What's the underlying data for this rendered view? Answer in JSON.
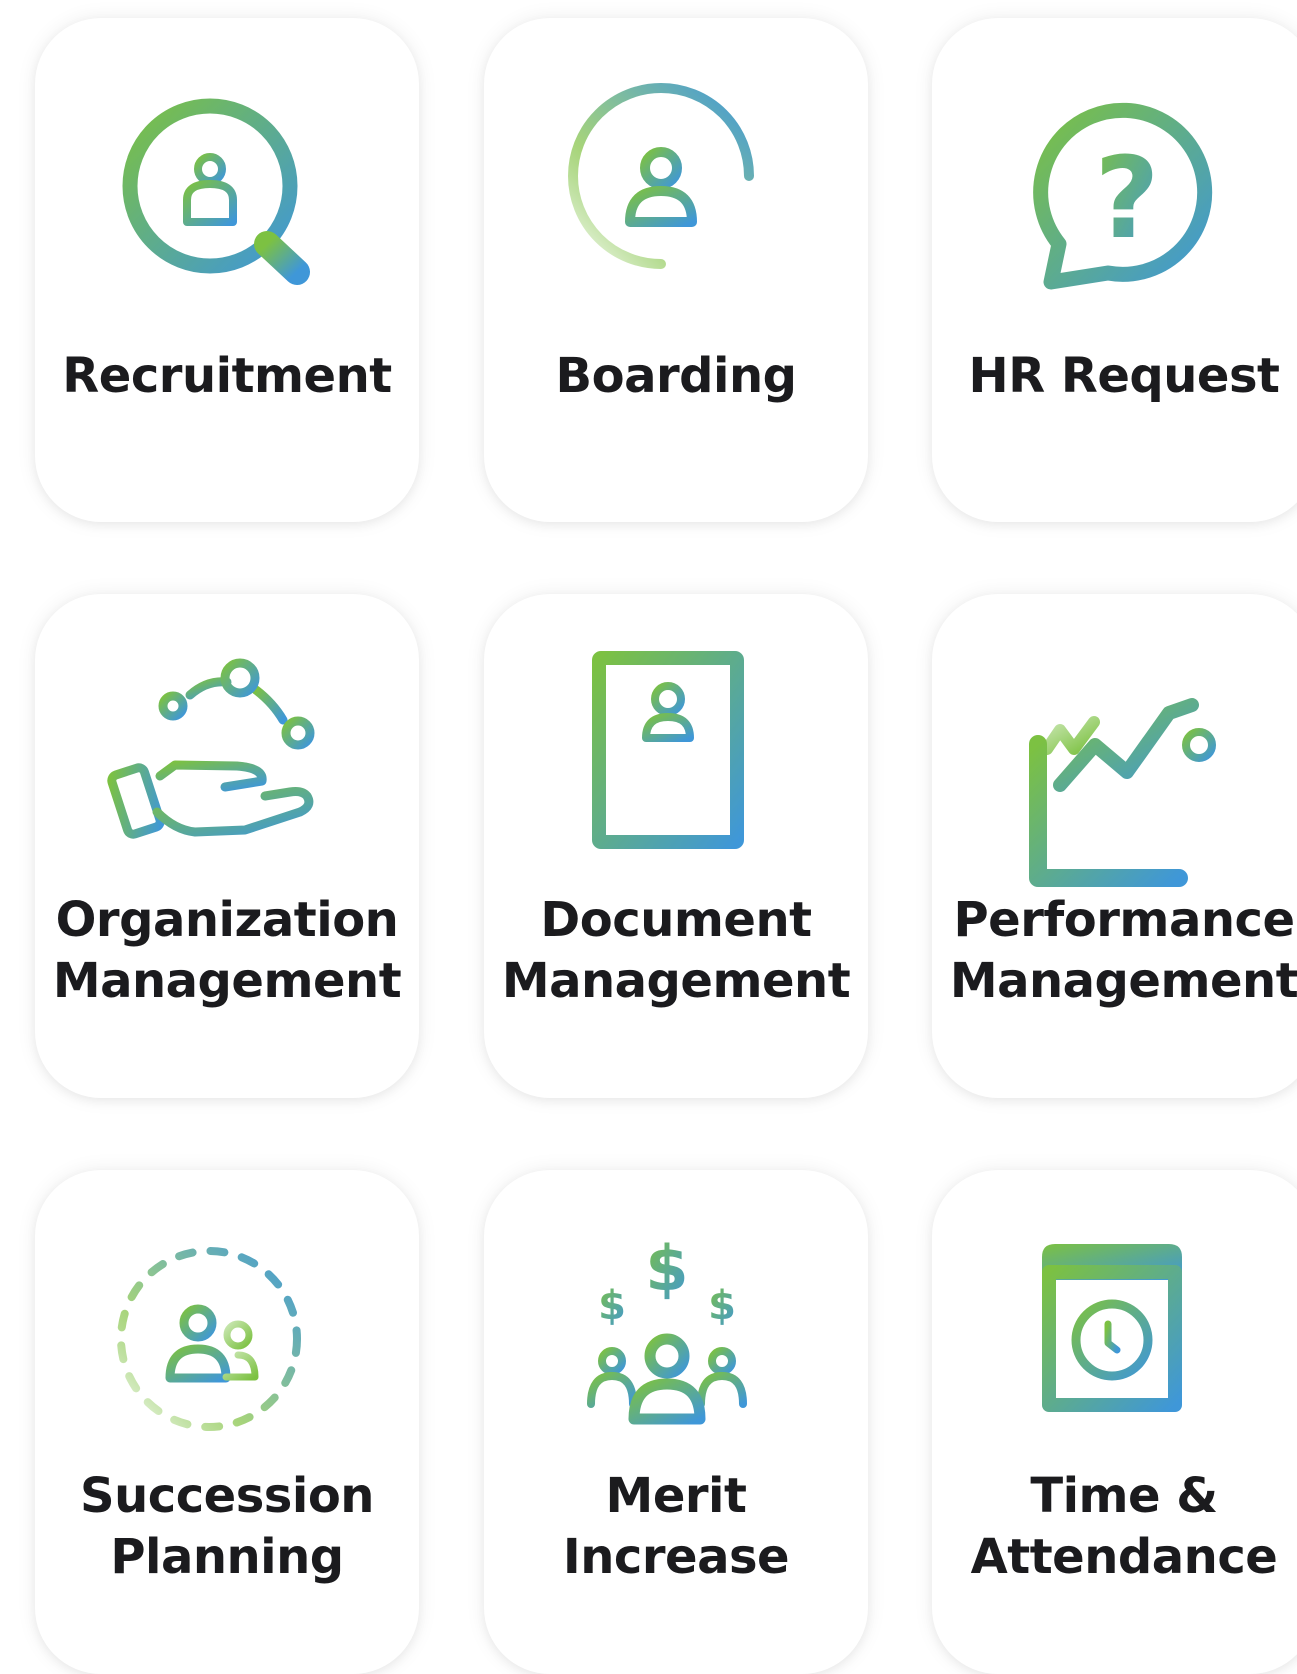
{
  "colors": {
    "gradient_start": "#7cc142",
    "gradient_end": "#3f97d8",
    "label_text": "#1b1b1e",
    "card_background": "#ffffff"
  },
  "cards": [
    {
      "icon": "recruitment-search-icon",
      "lines": [
        "Recruitment"
      ]
    },
    {
      "icon": "boarding-progress-icon",
      "lines": [
        "Boarding"
      ]
    },
    {
      "icon": "hr-request-question-icon",
      "lines": [
        "HR Request"
      ]
    },
    {
      "icon": "organization-hand-icon",
      "lines": [
        "Organization",
        "Management"
      ]
    },
    {
      "icon": "document-profile-icon",
      "lines": [
        "Document",
        "Management"
      ]
    },
    {
      "icon": "performance-chart-icon",
      "lines": [
        "Performance",
        "Management"
      ]
    },
    {
      "icon": "succession-people-icon",
      "lines": [
        "Succession",
        "Planning"
      ]
    },
    {
      "icon": "merit-dollar-people-icon",
      "lines": [
        "Merit",
        "Increase"
      ]
    },
    {
      "icon": "time-calendar-clock-icon",
      "lines": [
        "Time &",
        "Attendance"
      ]
    }
  ]
}
